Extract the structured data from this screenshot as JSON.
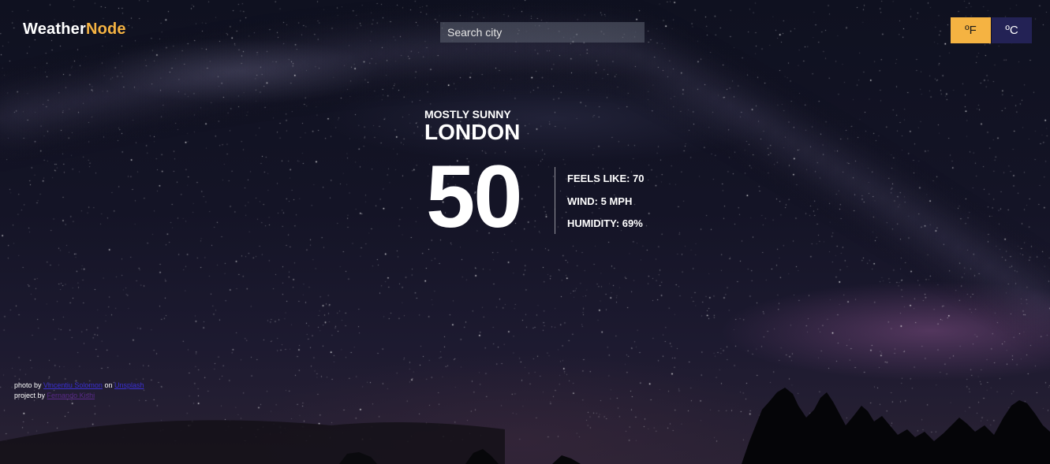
{
  "header": {
    "logo_primary": "Weather",
    "logo_accent": "Node",
    "search_placeholder": "Search city",
    "unit_fahrenheit_label": "ºF",
    "unit_celsius_label": "ºC"
  },
  "weather": {
    "condition": "MOSTLY SUNNY",
    "city": "LONDON",
    "temperature": "50",
    "feels_like": "FEELS LIKE: 70",
    "wind": "WIND: 5 MPH",
    "humidity": "HUMIDITY: 69%"
  },
  "footer": {
    "photo_prefix": "photo by",
    "photo_author": "Vincentiu Solomon",
    "photo_on": "on",
    "photo_source": "Unsplash",
    "project_prefix": "project by",
    "project_author": "Fernando Kishi"
  },
  "colors": {
    "accent": "#f5b342",
    "celsius_button": "#232255"
  }
}
